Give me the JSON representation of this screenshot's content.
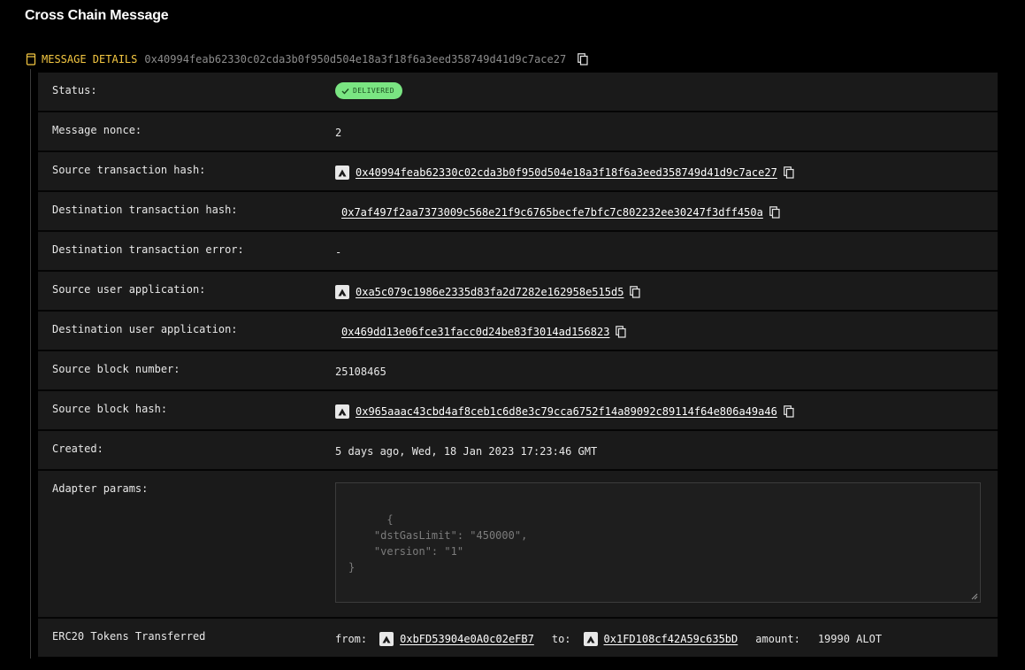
{
  "page": {
    "title": "Cross Chain Message"
  },
  "section": {
    "title": "MESSAGE DETAILS",
    "hash": "0x40994feab62330c02cda3b0f950d504e18a3f18f6a3eed358749d41d9c7ace27"
  },
  "details": {
    "status_label": "Status:",
    "status_value": "DELIVERED",
    "nonce_label": "Message nonce:",
    "nonce_value": "2",
    "src_tx_label": "Source transaction hash:",
    "src_tx_value": "0x40994feab62330c02cda3b0f950d504e18a3f18f6a3eed358749d41d9c7ace27",
    "dst_tx_label": "Destination transaction hash:",
    "dst_tx_value": "0x7af497f2aa7373009c568e21f9c6765becfe7bfc7c802232ee30247f3dff450a",
    "dst_err_label": "Destination transaction error:",
    "dst_err_value": "-",
    "src_ua_label": "Source user application:",
    "src_ua_value": "0xa5c079c1986e2335d83fa2d7282e162958e515d5",
    "dst_ua_label": "Destination user application:",
    "dst_ua_value": "0x469dd13e06fce31facc0d24be83f3014ad156823",
    "src_block_label": "Source block number:",
    "src_block_value": "25108465",
    "src_block_hash_label": "Source block hash:",
    "src_block_hash_value": "0x965aaac43cbd4af8ceb1c6d8e3c79cca6752f14a89092c89114f64e806a49a46",
    "created_label": "Created:",
    "created_value": "5 days ago, Wed, 18 Jan 2023 17:23:46 GMT",
    "adapter_label": "Adapter params:",
    "adapter_value": "{\n    \"dstGasLimit\": \"450000\",\n    \"version\": \"1\"\n}",
    "erc20_label": "ERC20 Tokens Transferred",
    "erc20_from_label": "from:",
    "erc20_from_value": "0xbFD53904e0A0c02eFB7",
    "erc20_to_label": "to:",
    "erc20_to_value": "0x1FD108cf42A59c635bD",
    "erc20_amount_label": "amount:",
    "erc20_amount_value": "19990 ALOT"
  },
  "icons": {
    "chain": "avalanche-icon",
    "copy": "copy-icon",
    "section": "document-icon",
    "status": "check-icon"
  },
  "colors": {
    "accent": "#f5c842",
    "badge_bg": "#7ae582",
    "badge_text": "#1b4d1f",
    "row_bg": "#1a1a1a",
    "page_bg": "#000000"
  }
}
